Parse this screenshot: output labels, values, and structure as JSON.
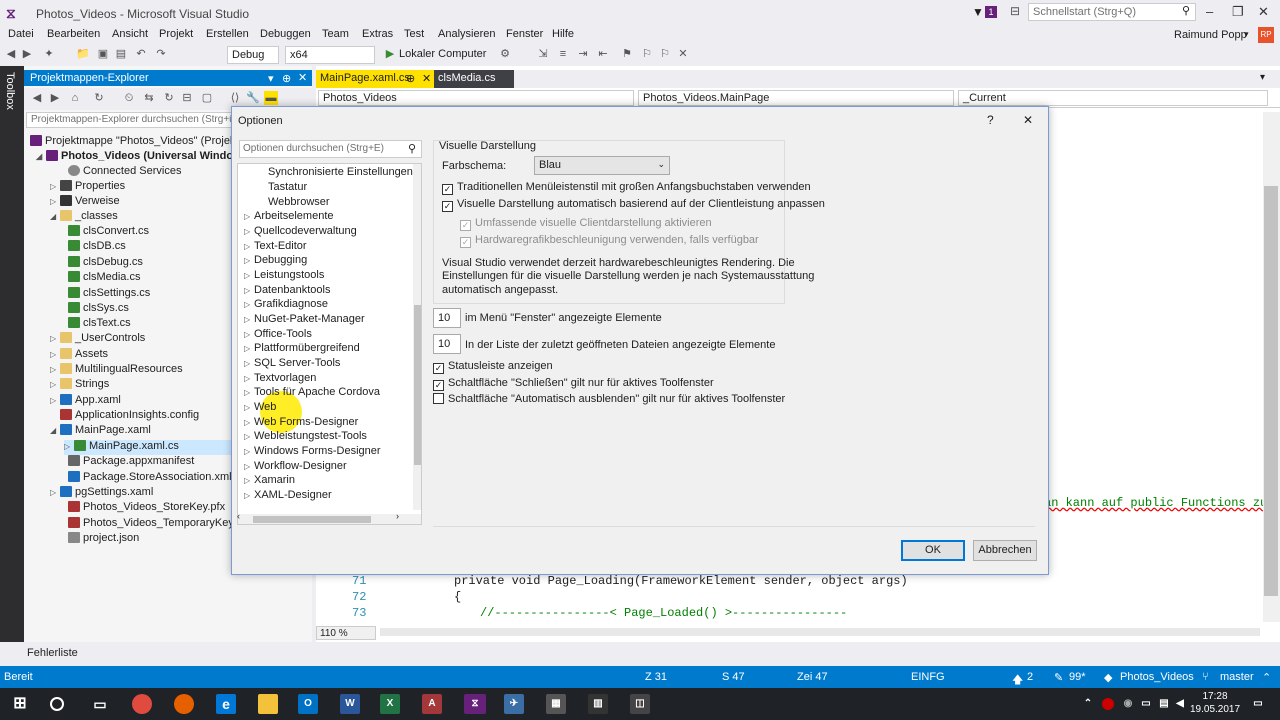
{
  "window": {
    "title": "Photos_Videos - Microsoft Visual Studio",
    "quick_launch": "Schnellstart (Strg+Q)",
    "notification_count": "1",
    "user": "Raimund Popp",
    "avatar": "RP"
  },
  "menu": [
    "Datei",
    "Bearbeiten",
    "Ansicht",
    "Projekt",
    "Erstellen",
    "Debuggen",
    "Team",
    "Extras",
    "Test",
    "Analysieren",
    "Fenster",
    "Hilfe"
  ],
  "toolbar": {
    "config": "Debug",
    "platform": "x64",
    "run": "Lokaler Computer"
  },
  "toolbox": "Toolbox",
  "solution": {
    "header": "Projektmappen-Explorer",
    "search": "Projektmappen-Explorer durchsuchen (Strg+ü)",
    "items": [
      "Projektmappe \"Photos_Videos\" (Projekt",
      "Photos_Videos (Universal Windows",
      "Connected Services",
      "Properties",
      "Verweise",
      "_classes",
      "clsConvert.cs",
      "clsDB.cs",
      "clsDebug.cs",
      "clsMedia.cs",
      "clsSettings.cs",
      "clsSys.cs",
      "clsText.cs",
      "_UserControls",
      "Assets",
      "MultilingualResources",
      "Strings",
      "App.xaml",
      "ApplicationInsights.config",
      "MainPage.xaml",
      "MainPage.xaml.cs",
      "Package.appxmanifest",
      "Package.StoreAssociation.xml",
      "pgSettings.xaml",
      "Photos_Videos_StoreKey.pfx",
      "Photos_Videos_TemporaryKey.pfx",
      "project.json"
    ]
  },
  "editor": {
    "tabs": [
      "MainPage.xaml.cs",
      "clsMedia.cs"
    ],
    "nav1": "Photos_Videos",
    "nav2": "Photos_Videos.MainPage",
    "nav3": "_Current",
    "zoom": "110 %",
    "right_text": "an kann auf public Functions zug",
    "lines": [
      {
        "n": "71",
        "text": "private void Page_Loading(FrameworkElement sender, object args)"
      },
      {
        "n": "72",
        "text": "{"
      },
      {
        "n": "73",
        "text": "//----------------< Page_Loaded() >----------------"
      }
    ]
  },
  "dialog": {
    "title": "Optionen",
    "help": "?",
    "close": "✕",
    "search": "Optionen durchsuchen (Strg+E)",
    "tree": [
      "Synchronisierte Einstellungen",
      "Tastatur",
      "Webbrowser",
      "Arbeitselemente",
      "Quellcodeverwaltung",
      "Text-Editor",
      "Debugging",
      "Leistungstools",
      "Datenbanktools",
      "Grafikdiagnose",
      "NuGet-Paket-Manager",
      "Office-Tools",
      "Plattformübergreifend",
      "SQL Server-Tools",
      "Textvorlagen",
      "Tools für Apache Cordova",
      "Web",
      "Web Forms-Designer",
      "Webleistungstest-Tools",
      "Windows Forms-Designer",
      "Workflow-Designer",
      "Xamarin",
      "XAML-Designer"
    ],
    "group_title": "Visuelle Darstellung",
    "farbschema_label": "Farbschema:",
    "farbschema_value": "Blau",
    "cb1": "Traditionellen Menüleistenstil mit großen Anfangsbuchstaben verwenden",
    "cb2": "Visuelle Darstellung automatisch basierend auf der Clientleistung anpassen",
    "cb3": "Umfassende visuelle Clientdarstellung aktivieren",
    "cb4": "Hardwaregrafikbeschleunigung verwenden, falls verfügbar",
    "info": [
      "Visual Studio verwendet derzeit hardwarebeschleunigtes Rendering. Die",
      "Einstellungen für die visuelle Darstellung werden je nach Systemausstattung",
      "automatisch angepasst."
    ],
    "num1": "10",
    "num1_label": "im Menü \"Fenster\" angezeigte Elemente",
    "num2": "10",
    "num2_label": "In der Liste der zuletzt geöffneten Dateien angezeigte Elemente",
    "cb5": "Statusleiste anzeigen",
    "cb6": "Schaltfläche \"Schließen\" gilt nur für aktives Toolfenster",
    "cb7": "Schaltfläche \"Automatisch ausblenden\" gilt nur für aktives Toolfenster",
    "ok": "OK",
    "cancel": "Abbrechen"
  },
  "fehlerliste": "Fehlerliste",
  "status": {
    "ready": "Bereit",
    "z": "Z 31",
    "s": "S 47",
    "zei": "Zei 47",
    "mode": "EINFG",
    "up": "2",
    "pencil": "99*",
    "project": "Photos_Videos",
    "branch": "master"
  },
  "clock": {
    "time": "17:28",
    "date": "19.05.2017"
  }
}
